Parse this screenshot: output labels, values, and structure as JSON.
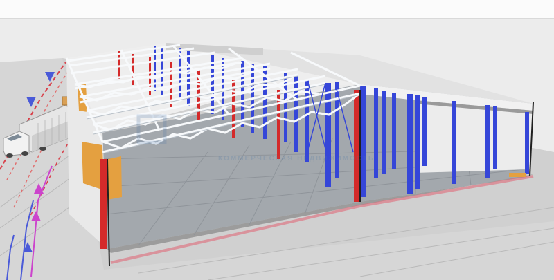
{
  "viewport": {
    "watermark_logo_text": "",
    "watermark_subtitle": "КОММЕРЧЕСКАЯ НЕДВИЖИМОСТЬ"
  },
  "model": {
    "object": "steel-frame-warehouse",
    "column_colors": {
      "red": "#d42a2a",
      "blue": "#3546d8"
    },
    "truss_color": "#f4f6f8",
    "floor_color": "#9ea3a8",
    "background_ground": "#cfcfcf"
  }
}
